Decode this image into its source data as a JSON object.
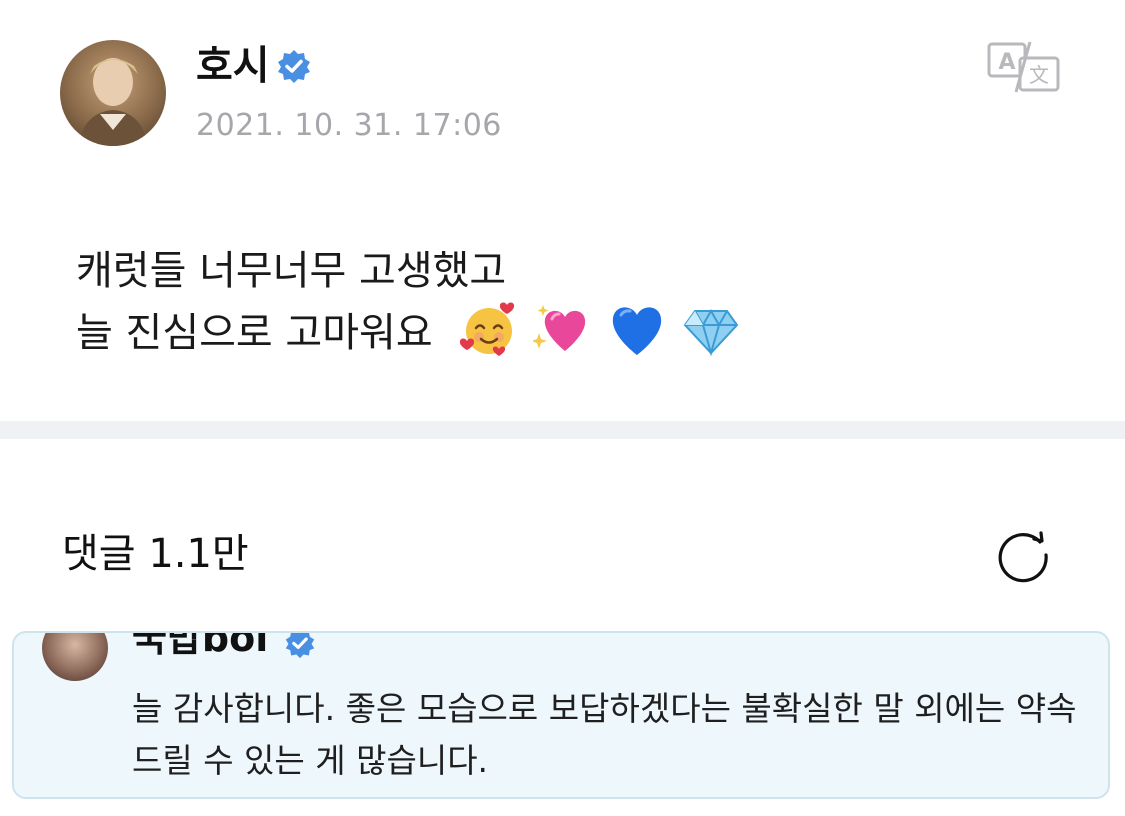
{
  "post": {
    "author_name": "호시",
    "timestamp": "2021. 10. 31. 17:06",
    "body_line1": "캐럿들 너무너무 고생했고",
    "body_line2": "늘 진심으로 고마워요",
    "emojis": [
      "smiling-face-with-hearts",
      "sparkling-heart",
      "blue-heart",
      "gem-stone"
    ],
    "verified_color": "#4a90e2"
  },
  "comments": {
    "label": "댓글 1.1만"
  },
  "reply": {
    "author_name": "국밥boi",
    "text": "늘 감사합니다. 좋은 모습으로 보답하겠다는 불확실한 말 외에는 약속드릴 수 있는 게 많습니다.",
    "card_bg": "#eef7fc",
    "card_border": "#cfe3ee"
  },
  "icons": {
    "translate": "translate-icon",
    "refresh": "refresh-icon",
    "verified": "verified-badge-icon"
  }
}
